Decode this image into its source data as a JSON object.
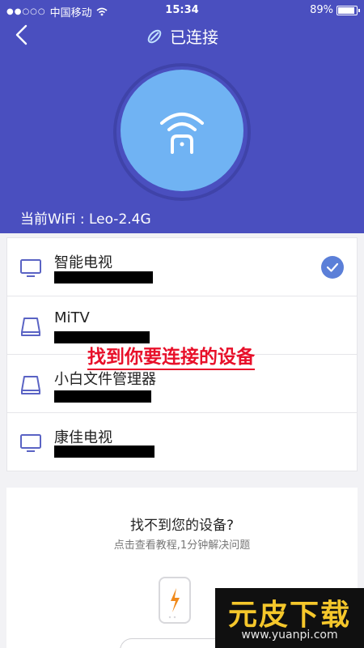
{
  "status": {
    "carrier": "中国移动",
    "time": "15:34",
    "battery": "89%",
    "battery_level": 0.89
  },
  "nav": {
    "title": "已连接"
  },
  "current_wifi": "当前WiFi : Leo-2.4G",
  "devices": [
    {
      "name": "智能电视",
      "icon": "tv-icon",
      "selected": true
    },
    {
      "name": "MiTV",
      "icon": "box-icon",
      "selected": false
    },
    {
      "name": "小白文件管理器",
      "icon": "box-icon",
      "selected": false
    },
    {
      "name": "康佳电视",
      "icon": "tv-icon",
      "selected": false
    }
  ],
  "caption": "找到你要连接的设备",
  "help": {
    "title": "找不到您的设备?",
    "subtitle": "点击查看教程,1分钟解决问题"
  },
  "watermark": {
    "title": "元皮下载",
    "url": "www.yuanpi.com"
  },
  "colors": {
    "header": "#4a4fbf",
    "accent": "#5b7fd8",
    "caption": "#e8102a"
  }
}
